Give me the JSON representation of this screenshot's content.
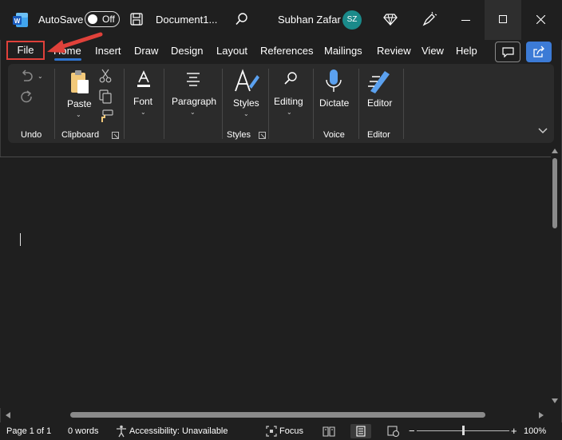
{
  "titlebar": {
    "autosave_label": "AutoSave",
    "autosave_state": "Off",
    "document_name": "Document1...",
    "user_name": "Subhan Zafar",
    "user_initials": "SZ"
  },
  "tabs": [
    "File",
    "Home",
    "Insert",
    "Draw",
    "Design",
    "Layout",
    "References",
    "Mailings",
    "Review",
    "View",
    "Help"
  ],
  "ribbon": {
    "paste": "Paste",
    "font": "Font",
    "paragraph": "Paragraph",
    "styles": "Styles",
    "editing": "Editing",
    "dictate": "Dictate",
    "editor": "Editor",
    "groups": {
      "undo": "Undo",
      "clipboard": "Clipboard",
      "styles": "Styles",
      "voice": "Voice",
      "editor": "Editor"
    }
  },
  "status": {
    "page": "Page 1 of 1",
    "words": "0 words",
    "accessibility": "Accessibility: Unavailable",
    "focus": "Focus",
    "zoom": "100%"
  },
  "colors": {
    "accent": "#2f74d0",
    "highlight_box": "#e0413a",
    "arrow": "#e0413a",
    "avatar": "#1a8a8a",
    "background": "#1f1f1f",
    "ribbon": "#2b2b2b"
  }
}
